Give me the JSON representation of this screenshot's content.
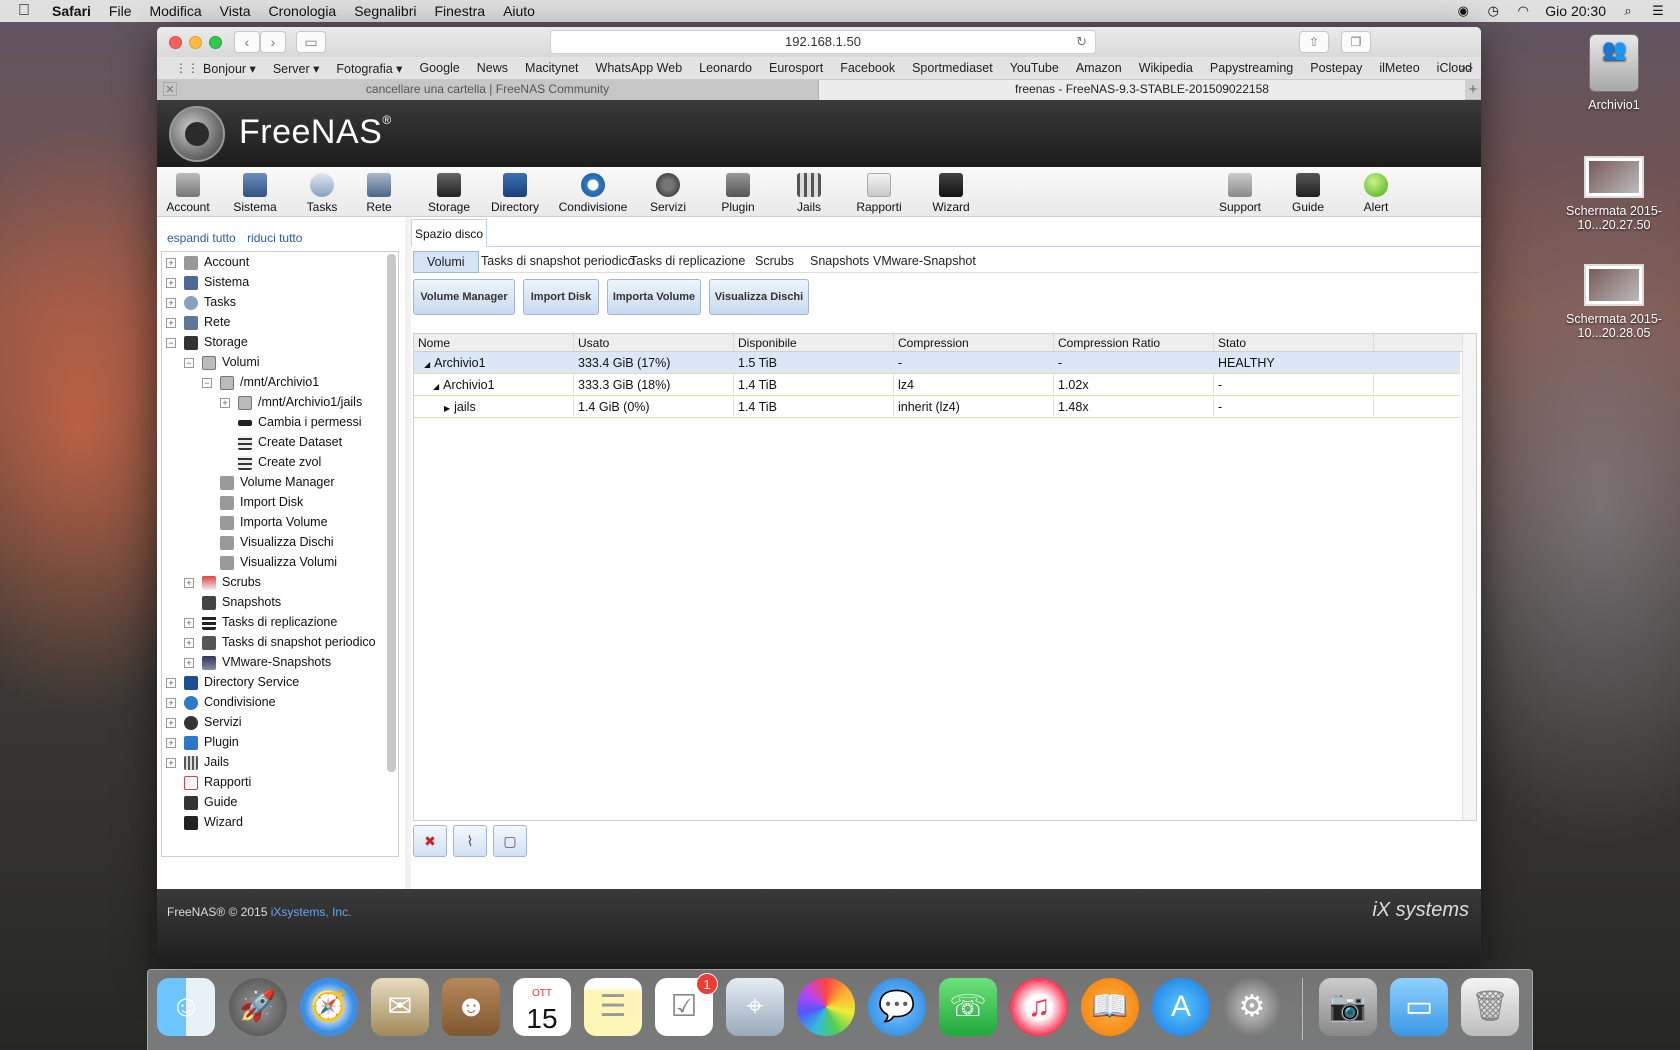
{
  "menubar": {
    "app_name": "Safari",
    "items": [
      "File",
      "Modifica",
      "Vista",
      "Cronologia",
      "Segnalibri",
      "Finestra",
      "Aiuto"
    ],
    "clock": "Gio 20:30"
  },
  "browser": {
    "address": "192.168.1.50",
    "favorites": [
      "Bonjour ▾",
      "Server ▾",
      "Fotografia ▾",
      "Google",
      "News",
      "Macitynet",
      "WhatsApp Web",
      "Leonardo",
      "Eurosport",
      "Facebook",
      "Sportmediaset",
      "YouTube",
      "Amazon",
      "Wikipedia",
      "Papystreaming",
      "Postepay",
      "ilMeteo",
      "iCloud"
    ],
    "more": ">>",
    "tabs": [
      {
        "label": "cancellare una cartella | FreeNAS Community"
      },
      {
        "label": "freenas - FreeNAS-9.3-STABLE-201509022158"
      }
    ]
  },
  "freenas": {
    "title": "FreeNAS",
    "reg": "®",
    "toolbar": [
      "Account",
      "Sistema",
      "Tasks",
      "Rete",
      "Storage",
      "Directory",
      "Condivisione",
      "Servizi",
      "Plugin",
      "Jails",
      "Rapporti",
      "Wizard"
    ],
    "toolbar_right": [
      "Support",
      "Guide",
      "Alert"
    ],
    "expand_all": "espandi tutto",
    "collapse_all": "riduci tutto",
    "tree": [
      {
        "label": "Account"
      },
      {
        "label": "Sistema"
      },
      {
        "label": "Tasks"
      },
      {
        "label": "Rete"
      },
      {
        "label": "Storage"
      },
      {
        "label": "Volumi"
      },
      {
        "label": "/mnt/Archivio1"
      },
      {
        "label": "/mnt/Archivio1/jails"
      },
      {
        "label": "Cambia i permessi"
      },
      {
        "label": "Create Dataset"
      },
      {
        "label": "Create zvol"
      },
      {
        "label": "Volume Manager"
      },
      {
        "label": "Import Disk"
      },
      {
        "label": "Importa Volume"
      },
      {
        "label": "Visualizza Dischi"
      },
      {
        "label": "Visualizza Volumi"
      },
      {
        "label": "Scrubs"
      },
      {
        "label": "Snapshots"
      },
      {
        "label": "Tasks di replicazione"
      },
      {
        "label": "Tasks di snapshot periodico"
      },
      {
        "label": "VMware-Snapshots"
      },
      {
        "label": "Directory Service"
      },
      {
        "label": "Condivisione"
      },
      {
        "label": "Servizi"
      },
      {
        "label": "Plugin"
      },
      {
        "label": "Jails"
      },
      {
        "label": "Rapporti"
      },
      {
        "label": "Guide"
      },
      {
        "label": "Wizard"
      }
    ],
    "main_tab": "Spazio disco",
    "subtabs": [
      "Volumi",
      "Tasks di snapshot periodico",
      "Tasks di replicazione",
      "Scrubs",
      "Snapshots",
      "VMware-Snapshot"
    ],
    "action_buttons": [
      "Volume Manager",
      "Import Disk",
      "Importa Volume",
      "Visualizza Dischi"
    ],
    "table": {
      "headers": [
        "Nome",
        "Usato",
        "Disponibile",
        "Compression",
        "Compression Ratio",
        "Stato"
      ],
      "rows": [
        [
          "Archivio1",
          "333.4 GiB (17%)",
          "1.5 TiB",
          "-",
          "-",
          "HEALTHY"
        ],
        [
          "Archivio1",
          "333.3 GiB (18%)",
          "1.4 TiB",
          "lz4",
          "1.02x",
          "-"
        ],
        [
          "jails",
          "1.4 GiB (0%)",
          "1.4 TiB",
          "inherit (lz4)",
          "1.48x",
          "-"
        ]
      ]
    },
    "footer_copy": "FreeNAS® © 2015",
    "footer_link": "iXsystems, Inc.",
    "footer_brand": "iX systems"
  },
  "desktop": {
    "icons": [
      {
        "label": "Archivio1"
      },
      {
        "label": "Schermata 2015-10...20.27.50"
      },
      {
        "label": "Schermata 2015-10...20.28.05"
      }
    ]
  },
  "dock": {
    "calendar_month": "OTT",
    "calendar_day": "15",
    "reminders_badge": "1"
  }
}
